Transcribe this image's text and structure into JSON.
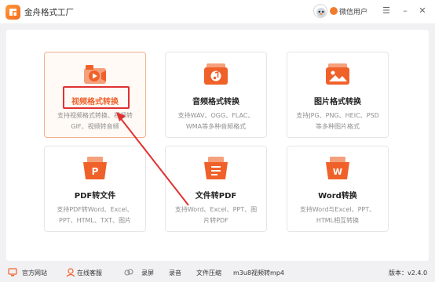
{
  "app": {
    "title": "金舟格式工厂"
  },
  "user": {
    "name": "微信用户"
  },
  "cards": [
    {
      "title": "视频格式转换",
      "desc": "支持视频格式转换、视频转GIF、视频转音频"
    },
    {
      "title": "音频格式转换",
      "desc": "支持WAV、OGG、FLAC、WMA等多种音频格式"
    },
    {
      "title": "图片格式转换",
      "desc": "支持JPG、PNG、HEIC、PSD等多种图片格式"
    },
    {
      "title": "PDF转文件",
      "desc": "支持PDF转Word、Excel、PPT、HTML、TXT、图片"
    },
    {
      "title": "文件转PDF",
      "desc": "支持Word、Excel、PPT、图片转PDF"
    },
    {
      "title": "Word转换",
      "desc": "支持Word与Excel、PPT、HTML相互转换"
    }
  ],
  "footer": {
    "website": "官方网站",
    "service": "在线客服",
    "record_screen": "录屏",
    "record_audio": "录音",
    "compress": "文件压缩",
    "m3u8": "m3u8视频转mp4",
    "version": "版本：v2.4.0"
  },
  "colors": {
    "accent": "#f0612a",
    "highlight": "#e03131"
  }
}
